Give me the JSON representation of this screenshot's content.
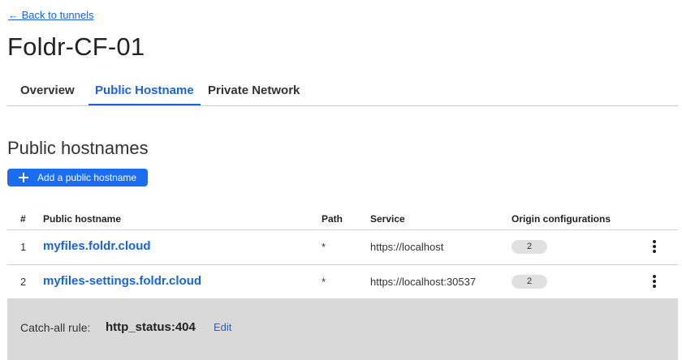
{
  "nav": {
    "back_link": "← Back to tunnels"
  },
  "page": {
    "title": "Foldr-CF-01"
  },
  "tabs": [
    {
      "label": "Overview",
      "active": false
    },
    {
      "label": "Public Hostname",
      "active": true
    },
    {
      "label": "Private Network",
      "active": false
    }
  ],
  "section": {
    "title": "Public hostnames",
    "add_button": {
      "label": "Add a public hostname",
      "icon": "plus-icon"
    }
  },
  "table": {
    "columns": [
      "#",
      "Public hostname",
      "Path",
      "Service",
      "Origin configurations"
    ],
    "rows": [
      {
        "index": "1",
        "hostname": "myfiles.foldr.cloud",
        "path": "*",
        "service": "https://localhost",
        "origin_configurations": "2",
        "menu_icon": "more-vertical-icon"
      },
      {
        "index": "2",
        "hostname": "myfiles-settings.foldr.cloud",
        "path": "*",
        "service": "https://localhost:30537",
        "origin_configurations": "2",
        "menu_icon": "more-vertical-icon"
      }
    ]
  },
  "catch_all": {
    "label": "Catch-all rule:",
    "value": "http_status:404",
    "edit_label": "Edit"
  },
  "colors": {
    "accent": "#1a63d8",
    "button": "#1a6cf0",
    "catch_all_bg": "#d9d9d9",
    "badge_bg": "#e0e0e0"
  }
}
